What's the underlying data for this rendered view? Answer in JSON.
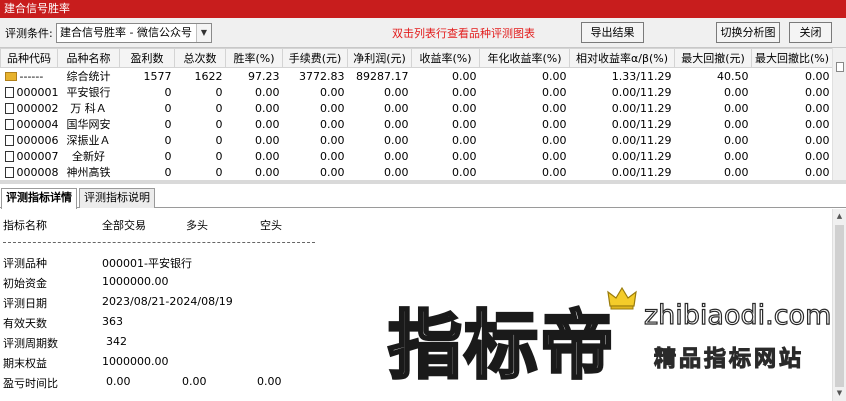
{
  "window": {
    "title": "建合信号胜率"
  },
  "toolbar": {
    "condition_label": "评测条件:",
    "condition_value": "建合信号胜率  -  微信公众号",
    "hint": "双击列表行查看品种评测图表",
    "export_label": "导出结果",
    "switch_label": "切换分析图",
    "close_label": "关闭"
  },
  "table": {
    "columns": [
      "品种代码",
      "品种名称",
      "盈利数",
      "总次数",
      "胜率(%)",
      "手续费(元)",
      "净利润(元)",
      "收益率(%)",
      "年化收益率(%)",
      "相对收益率α/β(%)",
      "最大回撤(元)",
      "最大回撤比(%)"
    ],
    "rows": [
      {
        "code": "------",
        "name": "综合统计",
        "wins": "1577",
        "total": "1622",
        "winrate": "97.23",
        "fee": "3772.83",
        "profit": "89287.17",
        "ret": "0.00",
        "annual": "0.00",
        "rel": "1.33/11.29",
        "maxdd": "40.50",
        "maxddr": "0.00"
      },
      {
        "code": "000001",
        "name": "平安银行",
        "wins": "0",
        "total": "0",
        "winrate": "0.00",
        "fee": "0.00",
        "profit": "0.00",
        "ret": "0.00",
        "annual": "0.00",
        "rel": "0.00/11.29",
        "maxdd": "0.00",
        "maxddr": "0.00"
      },
      {
        "code": "000002",
        "name": "万 科Ａ",
        "wins": "0",
        "total": "0",
        "winrate": "0.00",
        "fee": "0.00",
        "profit": "0.00",
        "ret": "0.00",
        "annual": "0.00",
        "rel": "0.00/11.29",
        "maxdd": "0.00",
        "maxddr": "0.00"
      },
      {
        "code": "000004",
        "name": "国华网安",
        "wins": "0",
        "total": "0",
        "winrate": "0.00",
        "fee": "0.00",
        "profit": "0.00",
        "ret": "0.00",
        "annual": "0.00",
        "rel": "0.00/11.29",
        "maxdd": "0.00",
        "maxddr": "0.00"
      },
      {
        "code": "000006",
        "name": "深振业Ａ",
        "wins": "0",
        "total": "0",
        "winrate": "0.00",
        "fee": "0.00",
        "profit": "0.00",
        "ret": "0.00",
        "annual": "0.00",
        "rel": "0.00/11.29",
        "maxdd": "0.00",
        "maxddr": "0.00"
      },
      {
        "code": "000007",
        "name": "全新好",
        "wins": "0",
        "total": "0",
        "winrate": "0.00",
        "fee": "0.00",
        "profit": "0.00",
        "ret": "0.00",
        "annual": "0.00",
        "rel": "0.00/11.29",
        "maxdd": "0.00",
        "maxddr": "0.00"
      },
      {
        "code": "000008",
        "name": "神州高铁",
        "wins": "0",
        "total": "0",
        "winrate": "0.00",
        "fee": "0.00",
        "profit": "0.00",
        "ret": "0.00",
        "annual": "0.00",
        "rel": "0.00/11.29",
        "maxdd": "0.00",
        "maxddr": "0.00"
      }
    ]
  },
  "tabs": [
    {
      "label": "评测指标详情",
      "active": true
    },
    {
      "label": "评测指标说明",
      "active": false
    }
  ],
  "detail": {
    "header": {
      "name": "指标名称",
      "all": "全部交易",
      "long": "多头",
      "short": "空头"
    },
    "items": [
      {
        "label": "评测品种",
        "value": "000001-平安银行"
      },
      {
        "label": "初始资金",
        "value": "1000000.00"
      },
      {
        "label": "评测日期",
        "value": "2023/08/21-2024/08/19"
      },
      {
        "label": "有效天数",
        "value": "363"
      },
      {
        "label": "评测周期数",
        "value": "342"
      },
      {
        "label": "期末权益",
        "value": "1000000.00"
      }
    ],
    "ratio_row": {
      "label": "盈亏时间比",
      "all": "0.00",
      "long": "0.00",
      "short": "0.00"
    }
  },
  "watermark": {
    "brand": "指标帝",
    "url": "zhibiaodi.com",
    "tagline": "精品指标网站"
  },
  "colors": {
    "title_bar": "#c81d1d",
    "hint_text": "#e21b1b"
  }
}
